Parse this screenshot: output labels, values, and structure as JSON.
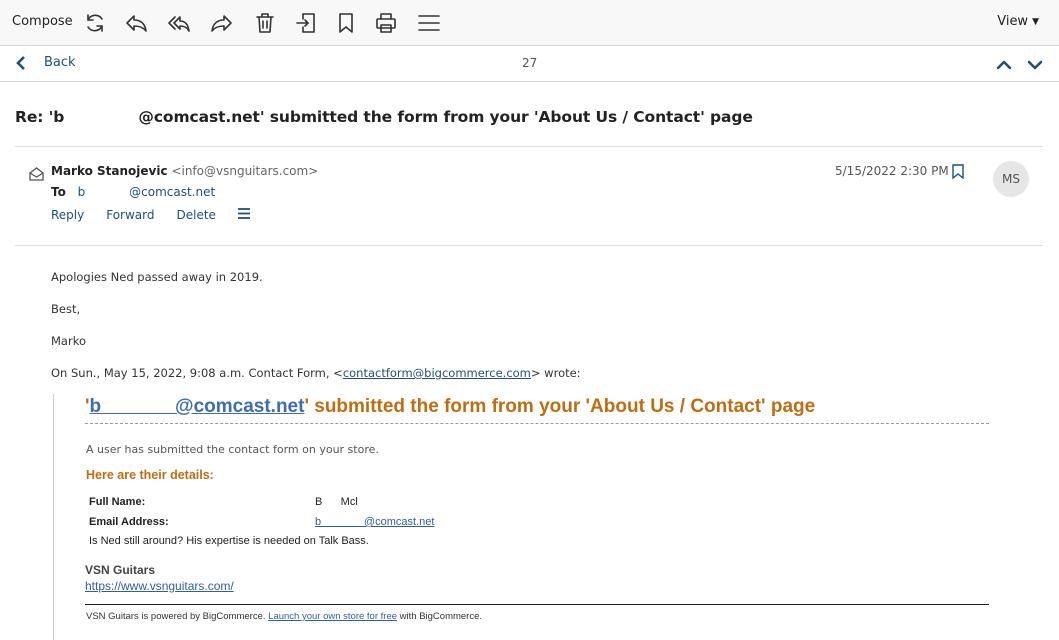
{
  "toolbar": {
    "compose_label": "Compose",
    "view_label": "View",
    "icons": [
      "refresh-icon",
      "reply-icon",
      "reply-all-icon",
      "forward-icon",
      "delete-icon",
      "move-icon",
      "bookmark-icon",
      "print-icon",
      "menu-icon"
    ]
  },
  "nav": {
    "back_label": "Back",
    "counter": "27"
  },
  "message": {
    "subject": "Re: 'b              @comcast.net' submitted the form from your 'About Us / Contact' page",
    "sender_name": "Marko Stanojevic",
    "sender_email": "<info@vsnguitars.com>",
    "to_label": "To",
    "to_part1": "b",
    "to_part2": "@comcast.net",
    "datetime": "5/15/2022 2:30 PM",
    "avatar_initials": "MS",
    "actions": {
      "reply": "Reply",
      "forward": "Forward",
      "delete": "Delete"
    }
  },
  "body": {
    "line1": "Apologies Ned passed away in 2019.",
    "line2": "Best,",
    "line3": "Marko",
    "quote_intro_prefix": "On Sun., May 15, 2022, 9:08 a.m. Contact Form, <",
    "quote_intro_link": "contactform@bigcommerce.com",
    "quote_intro_suffix": "> wrote:"
  },
  "quoted": {
    "title_quote_open": "'",
    "title_link": "b              @comcast.net",
    "title_rest": "' submitted the form from your 'About Us / Contact' page",
    "intro": "A user has submitted the contact form on your store.",
    "details_heading": "Here are their details:",
    "full_name_label": "Full Name:",
    "full_name_value": "B      Mcl",
    "email_label": "Email Address:",
    "email_value": "b              @comcast.net",
    "message": "Is Ned still around? His expertise is needed on Talk Bass.",
    "store_name": "VSN Guitars",
    "store_url": "https://www.vsnguitars.com/",
    "footer_prefix": "VSN Guitars is powered by BigCommerce. ",
    "footer_link": "Launch your own store for free",
    "footer_suffix": " with BigCommerce."
  },
  "colors": {
    "link_blue": "#1f4f7a",
    "form_orange": "#c06d11",
    "form_link_blue": "#3c6cb1"
  }
}
